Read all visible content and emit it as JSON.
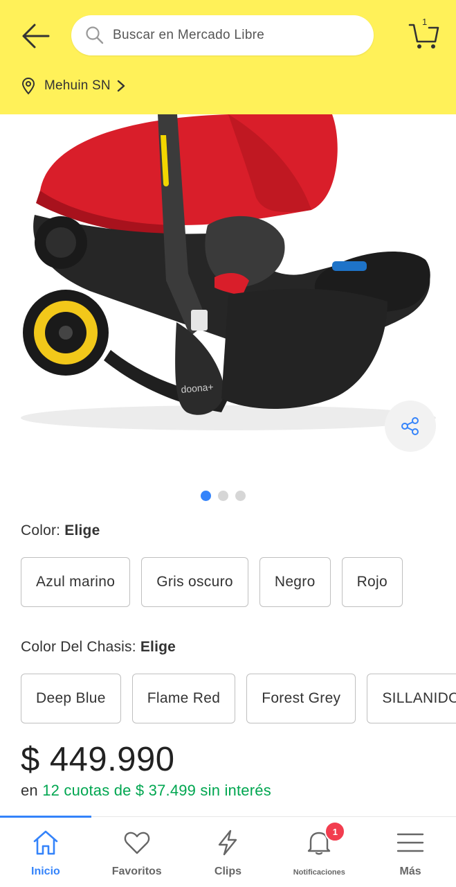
{
  "header": {
    "search_placeholder": "Buscar en Mercado Libre",
    "cart_count": "1",
    "location": "Mehuin SN",
    "background_color": "#fff159"
  },
  "gallery": {
    "image_description": "car-seat-stroller-red-black",
    "pages_total": 3,
    "active_page": 1
  },
  "variations": [
    {
      "label": "Color: ",
      "value": "Elige",
      "options": [
        "Azul marino",
        "Gris oscuro",
        "Negro",
        "Rojo"
      ]
    },
    {
      "label": "Color Del Chasis: ",
      "value": "Elige",
      "options": [
        "Deep Blue",
        "Flame Red",
        "Forest Grey",
        "SILLANIDO"
      ]
    }
  ],
  "price": {
    "amount": "$ 449.990",
    "prefix": "en ",
    "installments": "12 cuotas de $ 37.499 sin interés",
    "installments_color": "#00a650"
  },
  "bottom_nav": {
    "accent_color": "#3483fa",
    "items": [
      {
        "label": "Inicio",
        "icon": "home-icon"
      },
      {
        "label": "Favoritos",
        "icon": "heart-icon"
      },
      {
        "label": "Clips",
        "icon": "lightning-icon"
      },
      {
        "label": "Notificaciones",
        "icon": "bell-icon",
        "badge": "1"
      },
      {
        "label": "Más",
        "icon": "menu-icon"
      }
    ]
  }
}
